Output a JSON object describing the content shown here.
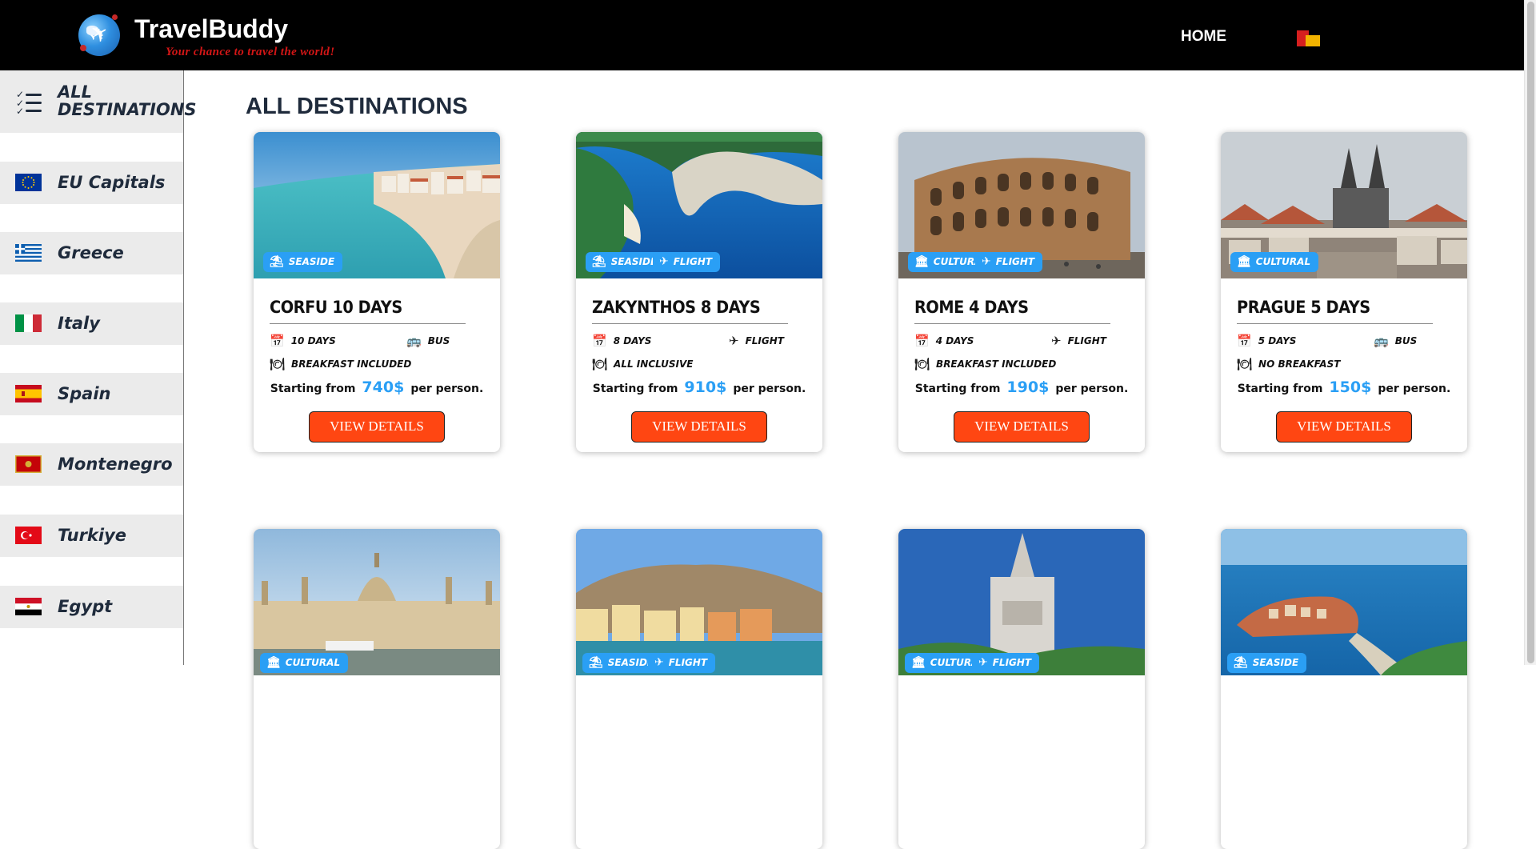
{
  "header": {
    "brand": "TravelBuddy",
    "tagline": "Your chance to travel the world!",
    "nav_home": "HOME"
  },
  "sidebar": {
    "items": [
      {
        "label": "ALL DESTINATIONS",
        "icon": "list-check-icon"
      },
      {
        "label": "EU Capitals",
        "icon": "eu-flag-icon"
      },
      {
        "label": "Greece",
        "icon": "greece-flag-icon"
      },
      {
        "label": "Italy",
        "icon": "italy-flag-icon"
      },
      {
        "label": "Spain",
        "icon": "spain-flag-icon"
      },
      {
        "label": "Montenegro",
        "icon": "montenegro-flag-icon"
      },
      {
        "label": "Turkiye",
        "icon": "turkiye-flag-icon"
      },
      {
        "label": "Egypt",
        "icon": "egypt-flag-icon"
      }
    ]
  },
  "main": {
    "title": "ALL DESTINATIONS",
    "price_prefix": "Starting from",
    "price_suffix": "per person.",
    "button_label": "VIEW DETAILS",
    "cards": [
      {
        "title": "CORFU 10 DAYS",
        "duration": "10 DAYS",
        "transport": "BUS",
        "meal": "BREAKFAST INCLUDED",
        "price": "740$",
        "badges": [
          "SEASIDE"
        ]
      },
      {
        "title": "ZAKYNTHOS 8 DAYS",
        "duration": "8 DAYS",
        "transport": "FLIGHT",
        "meal": "ALL INCLUSIVE",
        "price": "910$",
        "badges": [
          "SEASIDE",
          "FLIGHT"
        ]
      },
      {
        "title": "ROME 4 DAYS",
        "duration": "4 DAYS",
        "transport": "FLIGHT",
        "meal": "BREAKFAST INCLUDED",
        "price": "190$",
        "badges": [
          "CULTURAL",
          "FLIGHT"
        ]
      },
      {
        "title": "PRAGUE 5 DAYS",
        "duration": "5 DAYS",
        "transport": "BUS",
        "meal": "NO BREAKFAST",
        "price": "150$",
        "badges": [
          "CULTURAL"
        ]
      },
      {
        "badges": [
          "CULTURAL"
        ]
      },
      {
        "badges": [
          "SEASIDE",
          "FLIGHT"
        ]
      },
      {
        "badges": [
          "CULTURAL",
          "FLIGHT"
        ]
      },
      {
        "badges": [
          "SEASIDE"
        ]
      }
    ]
  },
  "colors": {
    "accent_blue": "#2a9ff5",
    "button_orange": "#ff4612",
    "header_bg": "#000000",
    "tagline_red": "#d31616"
  }
}
